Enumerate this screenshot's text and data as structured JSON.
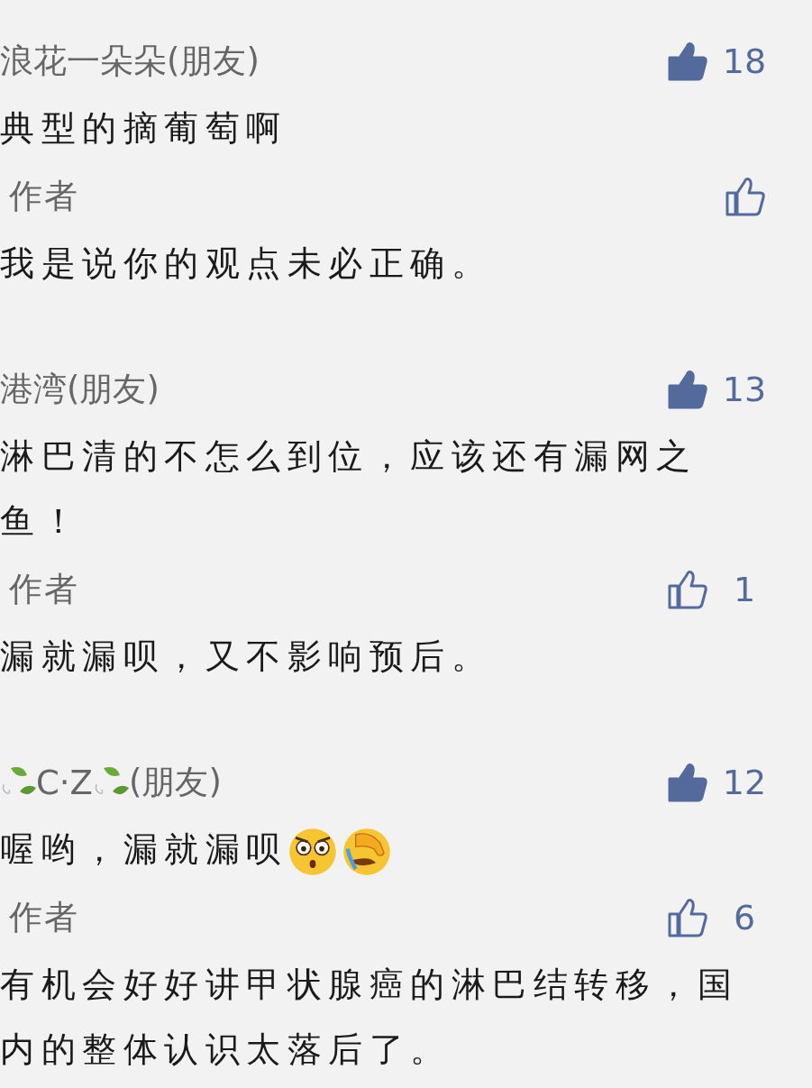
{
  "comments": [
    {
      "name": [
        {
          "kind": "text",
          "text": "浪花一朵朵(朋友)"
        }
      ],
      "likes": "18",
      "liked": true,
      "content": [
        {
          "kind": "text",
          "text": "典型的摘葡萄啊"
        }
      ],
      "reply": {
        "label": "作者",
        "liked": false,
        "content": [
          {
            "kind": "text",
            "text": "我是说你的观点未必正确。"
          }
        ]
      }
    },
    {
      "name": [
        {
          "kind": "text",
          "text": "港湾(朋友)"
        }
      ],
      "likes": "13",
      "liked": true,
      "content": [
        {
          "kind": "text",
          "text": "淋巴清的不怎么到位，应该还有漏网之鱼！"
        }
      ],
      "reply": {
        "label": "作者",
        "likes": "1",
        "liked": false,
        "content": [
          {
            "kind": "text",
            "text": "漏就漏呗，又不影响预后。"
          }
        ]
      }
    },
    {
      "name": [
        {
          "kind": "leaf"
        },
        {
          "kind": "text",
          "text": "C·Z"
        },
        {
          "kind": "leaf"
        },
        {
          "kind": "text",
          "text": "(朋友)"
        }
      ],
      "likes": "12",
      "liked": true,
      "content": [
        {
          "kind": "text",
          "text": "喔哟，漏就漏呗"
        },
        {
          "kind": "shocked"
        },
        {
          "kind": "facepalm"
        }
      ],
      "reply": {
        "label": "作者",
        "likes": "6",
        "liked": false,
        "content": [
          {
            "kind": "text",
            "text": "有机会好好讲甲状腺癌的淋巴结转移，国内的整体认识太落后了。"
          }
        ]
      }
    }
  ]
}
